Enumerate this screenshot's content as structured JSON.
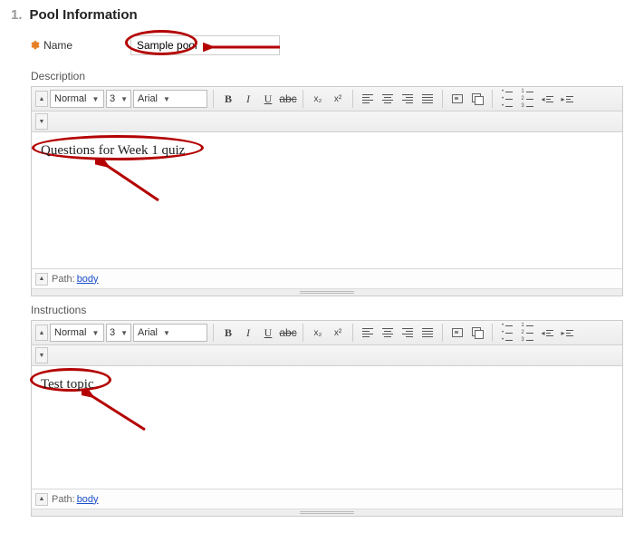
{
  "section": {
    "number": "1.",
    "title": "Pool Information"
  },
  "name_field": {
    "label": "Name",
    "value": "Sample pool"
  },
  "description": {
    "label": "Description",
    "content": "Questions for Week 1 quiz"
  },
  "instructions": {
    "label": "Instructions",
    "content": "Test topic"
  },
  "toolbar": {
    "format": "Normal",
    "size": "3",
    "font": "Arial",
    "buttons": {
      "bold": "B",
      "italic": "I",
      "underline": "U",
      "strike": "abc",
      "subscript": "x₂",
      "superscript": "x²"
    }
  },
  "path": {
    "label": "Path:",
    "value": "body"
  }
}
